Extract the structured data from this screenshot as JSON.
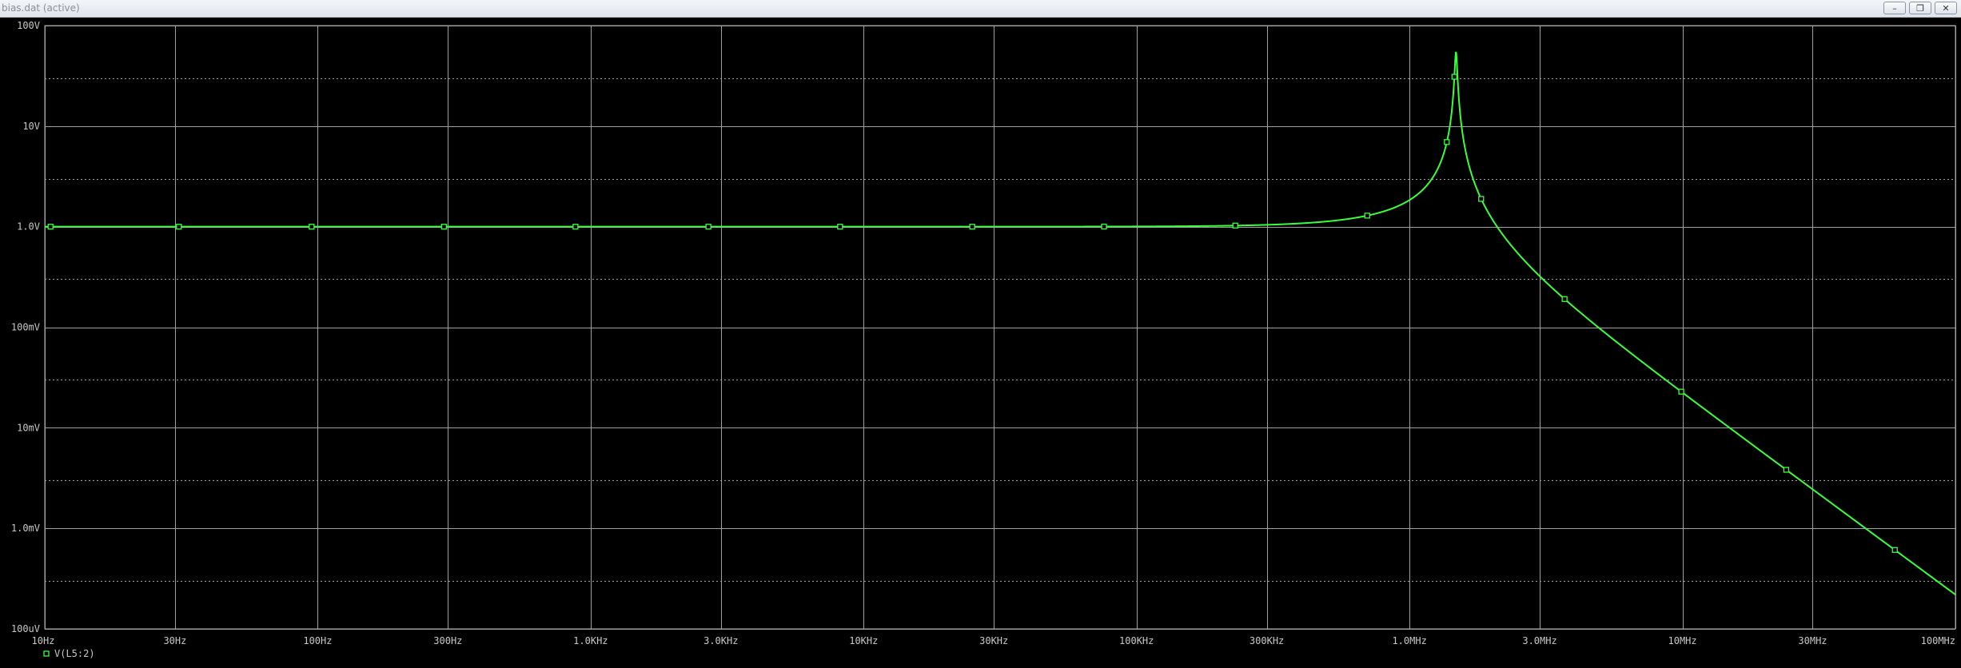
{
  "window": {
    "title": "bias.dat (active)",
    "buttons": [
      {
        "name": "minimize-button",
        "icon": "minimize-icon",
        "glyph": "–"
      },
      {
        "name": "restore-button",
        "icon": "restore-icon",
        "glyph": "❐"
      },
      {
        "name": "close-button",
        "icon": "close-icon",
        "glyph": "✕"
      }
    ]
  },
  "colors": {
    "background": "#000000",
    "grid": "#a0a0a0",
    "trace": "#39ff3a",
    "axis_text": "#c8c8c8"
  },
  "chart_data": {
    "type": "line",
    "x_scale": "log",
    "y_scale": "log",
    "xlim": [
      10,
      100000000
    ],
    "ylim": [
      0.0001,
      100
    ],
    "x_ticks": [
      {
        "value": 10,
        "label": "10Hz"
      },
      {
        "value": 30,
        "label": "30Hz"
      },
      {
        "value": 100,
        "label": "100Hz"
      },
      {
        "value": 300,
        "label": "300Hz"
      },
      {
        "value": 1000,
        "label": "1.0KHz"
      },
      {
        "value": 3000,
        "label": "3.0KHz"
      },
      {
        "value": 10000,
        "label": "10KHz"
      },
      {
        "value": 30000,
        "label": "30KHz"
      },
      {
        "value": 100000,
        "label": "100KHz"
      },
      {
        "value": 300000,
        "label": "300KHz"
      },
      {
        "value": 1000000,
        "label": "1.0MHz"
      },
      {
        "value": 3000000,
        "label": "3.0MHz"
      },
      {
        "value": 10000000,
        "label": "10MHz"
      },
      {
        "value": 30000000,
        "label": "30MHz"
      },
      {
        "value": 100000000,
        "label": "100MHz"
      }
    ],
    "y_ticks": [
      {
        "value": 100,
        "label": "100V"
      },
      {
        "value": 10,
        "label": "10V"
      },
      {
        "value": 1,
        "label": "1.0V"
      },
      {
        "value": 0.1,
        "label": "100mV"
      },
      {
        "value": 0.01,
        "label": "10mV"
      },
      {
        "value": 0.001,
        "label": "1.0mV"
      },
      {
        "value": 0.0001,
        "label": "100uV"
      }
    ],
    "y_minor_dotted": [
      30,
      3,
      0.3,
      0.03,
      0.003,
      0.0003
    ],
    "grid": true,
    "legend_position": "bottom-left",
    "series": [
      {
        "name": "V(L5:2)",
        "color": "#39ff3a",
        "model": {
          "resonance_hz": 1480000,
          "q": 55
        },
        "x_max": 100000000,
        "markers_x": [
          10.5,
          31,
          95,
          290,
          880,
          2700,
          8200,
          25000,
          76000,
          230000,
          700000,
          1370000,
          1460000,
          1830000,
          3700000,
          9900000,
          24000000,
          60000000
        ]
      }
    ]
  }
}
